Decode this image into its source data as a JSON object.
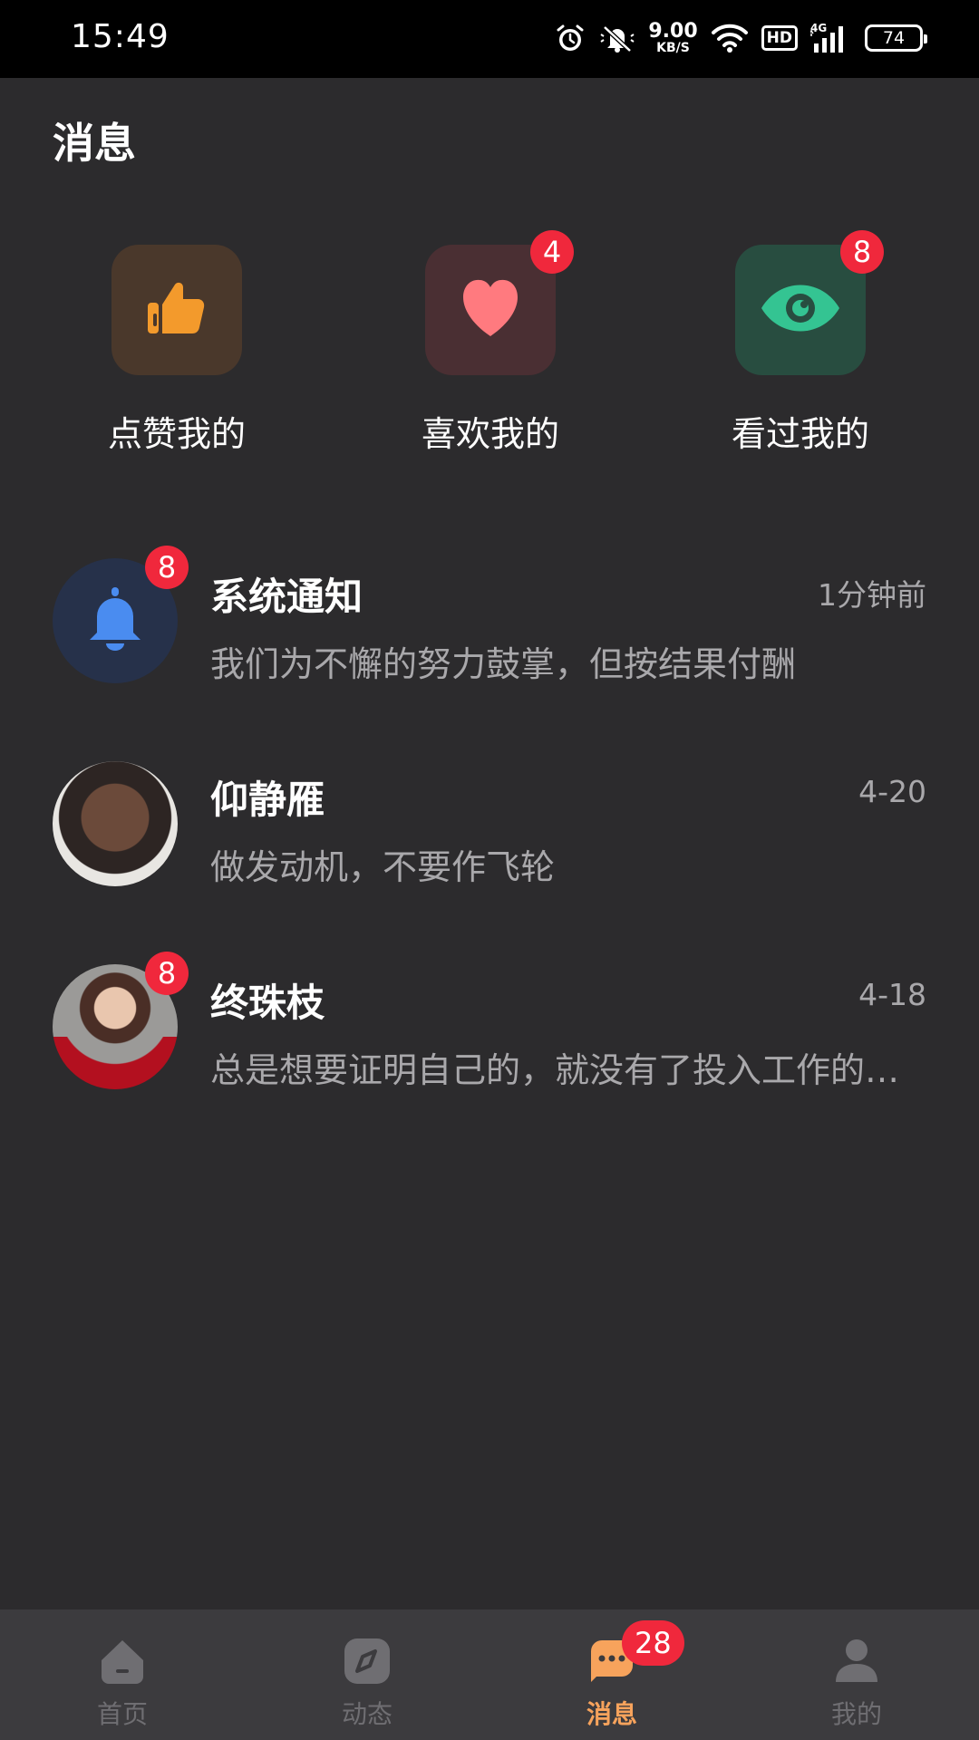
{
  "status_bar": {
    "time": "15:49",
    "net_speed_value": "9.00",
    "net_speed_unit": "KB/S",
    "hd_label": "HD",
    "network_type": "4G",
    "battery_level": "74"
  },
  "header": {
    "title": "消息"
  },
  "quick_entries": [
    {
      "label": "点赞我的",
      "icon": "thumbs-up-icon",
      "badge": ""
    },
    {
      "label": "喜欢我的",
      "icon": "heart-icon",
      "badge": "4"
    },
    {
      "label": "看过我的",
      "icon": "eye-icon",
      "badge": "8"
    }
  ],
  "messages": [
    {
      "name": "系统通知",
      "time": "1分钟前",
      "preview": "我们为不懈的努力鼓掌，但按结果付酬",
      "badge": "8",
      "avatar": "bell-icon"
    },
    {
      "name": "仰静雁",
      "time": "4-20",
      "preview": "做发动机，不要作飞轮",
      "badge": "",
      "avatar": "user-photo"
    },
    {
      "name": "终珠枝",
      "time": "4-18",
      "preview": "总是想要证明自己的，就没有了投入工作的热情",
      "badge": "8",
      "avatar": "user-photo"
    }
  ],
  "tab_bar": {
    "tabs": [
      {
        "label": "首页",
        "icon": "home-icon",
        "active": false
      },
      {
        "label": "动态",
        "icon": "compass-icon",
        "active": false
      },
      {
        "label": "消息",
        "icon": "chat-icon",
        "active": true,
        "badge": "28"
      },
      {
        "label": "我的",
        "icon": "profile-icon",
        "active": false
      }
    ]
  },
  "colors": {
    "background": "#2c2b2d",
    "badge": "#f0283c",
    "accent": "#f7a35c",
    "thumb": "#f39a2c",
    "heart": "#ff7a7f",
    "eye": "#34c492",
    "bell": "#4a8cf0"
  }
}
